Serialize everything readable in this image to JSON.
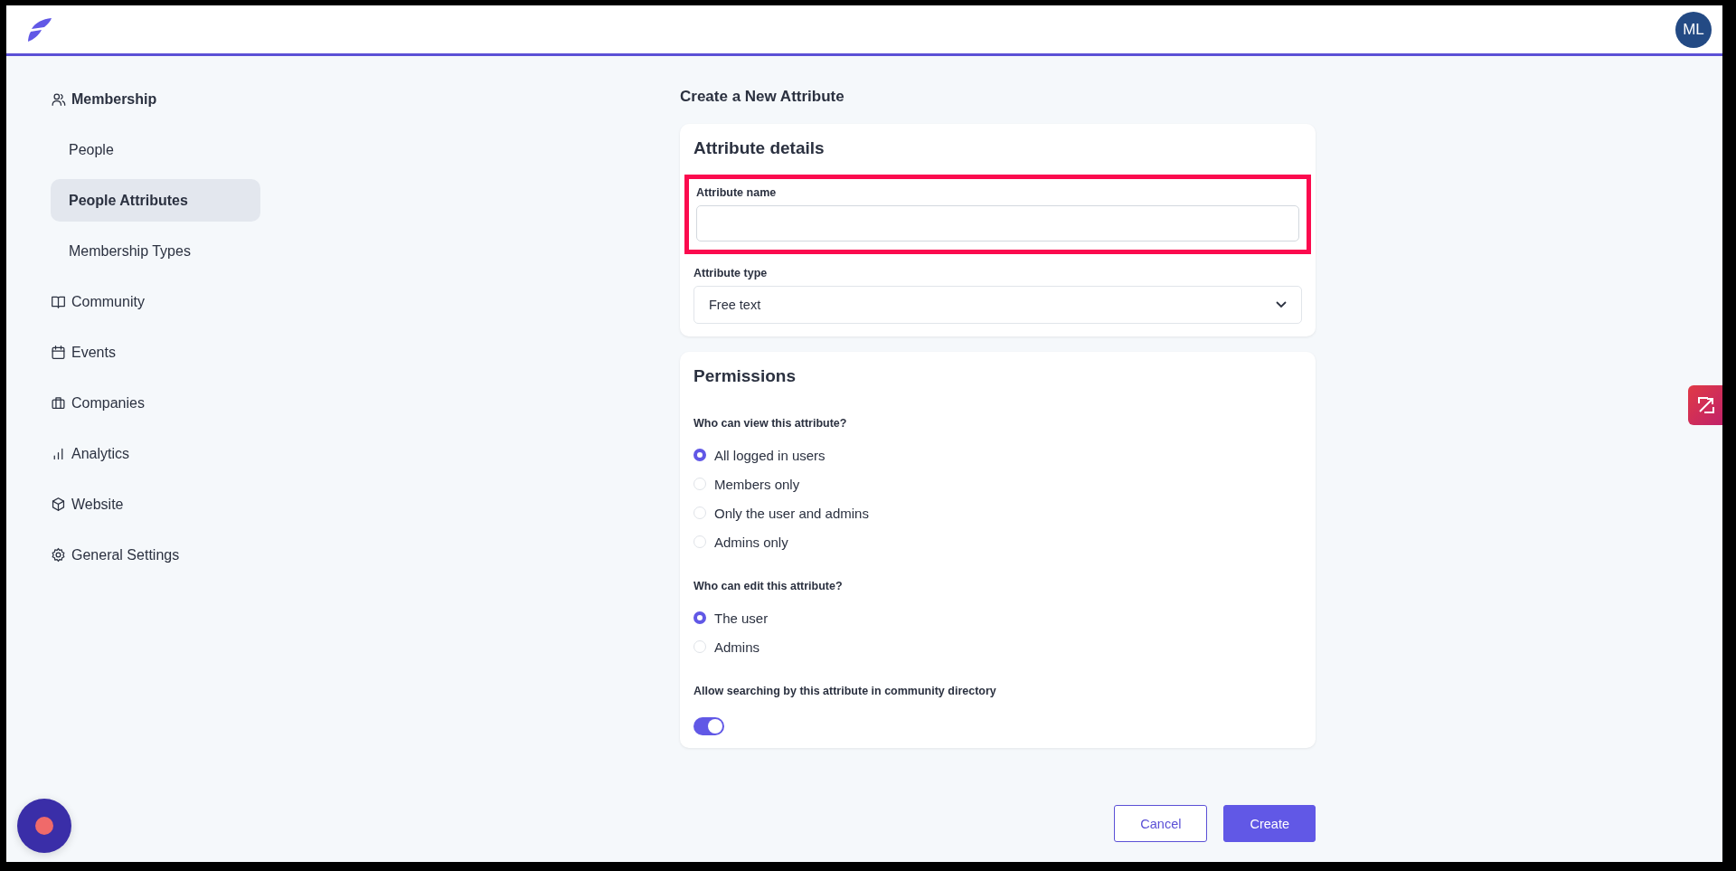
{
  "header": {
    "avatar": "ML"
  },
  "sidebar": {
    "items": [
      {
        "label": "Membership",
        "kind": "section",
        "selected": false
      },
      {
        "label": "People",
        "kind": "sub",
        "selected": false
      },
      {
        "label": "People Attributes",
        "kind": "sub",
        "selected": true
      },
      {
        "label": "Membership Types",
        "kind": "sub",
        "selected": false
      },
      {
        "label": "Community",
        "kind": "section",
        "selected": false
      },
      {
        "label": "Events",
        "kind": "section",
        "selected": false
      },
      {
        "label": "Companies",
        "kind": "section",
        "selected": false
      },
      {
        "label": "Analytics",
        "kind": "section",
        "selected": false
      },
      {
        "label": "Website",
        "kind": "section",
        "selected": false
      },
      {
        "label": "General Settings",
        "kind": "section",
        "selected": false
      }
    ]
  },
  "page_title": "Create a New Attribute",
  "details": {
    "title": "Attribute details",
    "name_field": {
      "label": "Attribute name",
      "highlighted": true
    },
    "type_field": {
      "label": "Attribute type",
      "value": "Free text"
    }
  },
  "permissions": {
    "title": "Permissions",
    "groups": [
      {
        "question": "Who can view this attribute?",
        "options": [
          {
            "label": "All logged in users",
            "selected": true
          },
          {
            "label": "Members only",
            "selected": false
          },
          {
            "label": "Only the user and admins",
            "selected": false
          },
          {
            "label": "Admins only",
            "selected": false
          }
        ]
      },
      {
        "question": "Who can edit this attribute?",
        "options": [
          {
            "label": "The user",
            "selected": true
          },
          {
            "label": "Admins",
            "selected": false
          }
        ]
      }
    ],
    "search_toggle": {
      "label": "Allow searching by this attribute in community directory",
      "on": true
    }
  },
  "buttons": [
    {
      "label": "Cancel",
      "kind": "secondary"
    },
    {
      "label": "Create",
      "kind": "primary"
    }
  ]
}
